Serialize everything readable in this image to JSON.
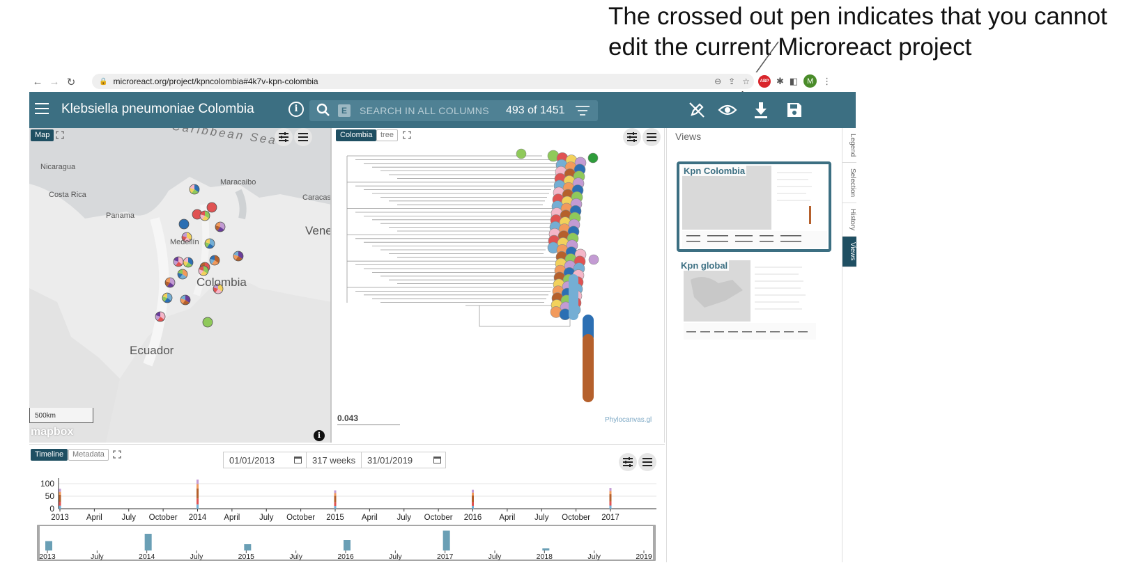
{
  "annotation": {
    "line1": "The crossed out pen indicates that you cannot",
    "line2": "edit the current Microreact project"
  },
  "browser": {
    "url": "microreact.org/project/kpncolombia#4k7v-kpn-colombia",
    "avatar_letter": "M",
    "abp_label": "ABP"
  },
  "app": {
    "title": "Klebsiella pneumoniae Colombia",
    "search_placeholder": "SEARCH IN ALL COLUMNS",
    "search_badge": "E",
    "count": "493 of 1451"
  },
  "map": {
    "tab": "Map",
    "labels": {
      "caribbean": "Caribbean Sea",
      "nicaragua": "Nicaragua",
      "maracaibo": "Maracaibo",
      "costa_rica": "Costa Rica",
      "caracas": "Caracas",
      "panama": "Panama",
      "vene": "Vene",
      "medellin": "Medellín",
      "colombia": "Colombia",
      "ecuador": "Ecuador"
    },
    "scale": "500km",
    "attribution": "mapbox"
  },
  "tree": {
    "tabs": [
      "Colombia",
      "tree"
    ],
    "scale_value": "0.043",
    "branding": "Phylocanvas.gl"
  },
  "timeline": {
    "tabs": [
      "Timeline",
      "Metadata"
    ],
    "start_date": "01/01/2013",
    "weeks": "317 weeks",
    "end_date": "31/01/2019",
    "y_ticks": [
      "100",
      "50",
      "0"
    ],
    "x_ticks": [
      "2013",
      "April",
      "July",
      "October",
      "2014",
      "April",
      "July",
      "October",
      "2015",
      "April",
      "July",
      "October",
      "2016",
      "April",
      "July",
      "October",
      "2017"
    ],
    "overview_ticks": [
      "2013",
      "July",
      "2014",
      "July",
      "2015",
      "July",
      "2016",
      "July",
      "2017",
      "July",
      "2018",
      "July",
      "2019"
    ],
    "overview_values": [
      0.45,
      0.8,
      0.3,
      0.5,
      0.95,
      0.1
    ]
  },
  "views": {
    "title": "Views",
    "items": [
      {
        "label": "Kpn Colombia",
        "selected": true
      },
      {
        "label": "Kpn global",
        "selected": false
      }
    ]
  },
  "side_tabs": [
    "Legend",
    "Selection",
    "History",
    "Views"
  ],
  "colors": {
    "appbar": "#3c6f82",
    "active_tab": "#1f4f62"
  }
}
